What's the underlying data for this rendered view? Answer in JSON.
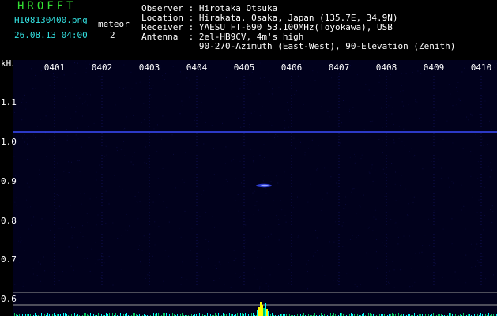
{
  "header": {
    "app_name": "HROFFT",
    "filename": "HI08130400.png",
    "datetime": "26.08.13 04:00",
    "event_type": "meteor",
    "event_count": "2"
  },
  "info": [
    {
      "label": "Observer",
      "sep": ":",
      "value": "Hirotaka Otsuka"
    },
    {
      "label": "Location",
      "sep": ":",
      "value": "Hirakata, Osaka, Japan (135.7E, 34.9N)"
    },
    {
      "label": "Receiver",
      "sep": ":",
      "value": "YAESU FT-690 53.100MHz(Toyokawa), USB"
    },
    {
      "label": "Antenna",
      "sep": ":",
      "value": "2el-HB9CV, 4m's high"
    },
    {
      "label": "",
      "sep": "",
      "value": "90-270-Azimuth (East-West), 90-Elevation (Zenith)"
    }
  ],
  "axis": {
    "unit": "kHz",
    "x_ticks": [
      "0401",
      "0402",
      "0403",
      "0404",
      "0405",
      "0406",
      "0407",
      "0408",
      "0409",
      "0410"
    ],
    "y_ticks": [
      "1.1",
      "1.0",
      "0.9",
      "0.8",
      "0.7",
      "0.6"
    ]
  },
  "colors": {
    "background": "#000000",
    "header_title": "#33e033",
    "header_file": "#33e0e0",
    "text": "#ffffff",
    "spectrogram_bg": "#01011c",
    "carrier": "#3a4cff",
    "meteor_echo": "#9aa8ff",
    "reference_line": "#9a9a9a",
    "spectrum_green": "#00c860",
    "spectrum_yellow": "#ffff00",
    "spectrum_cyan": "#00ffff"
  }
}
